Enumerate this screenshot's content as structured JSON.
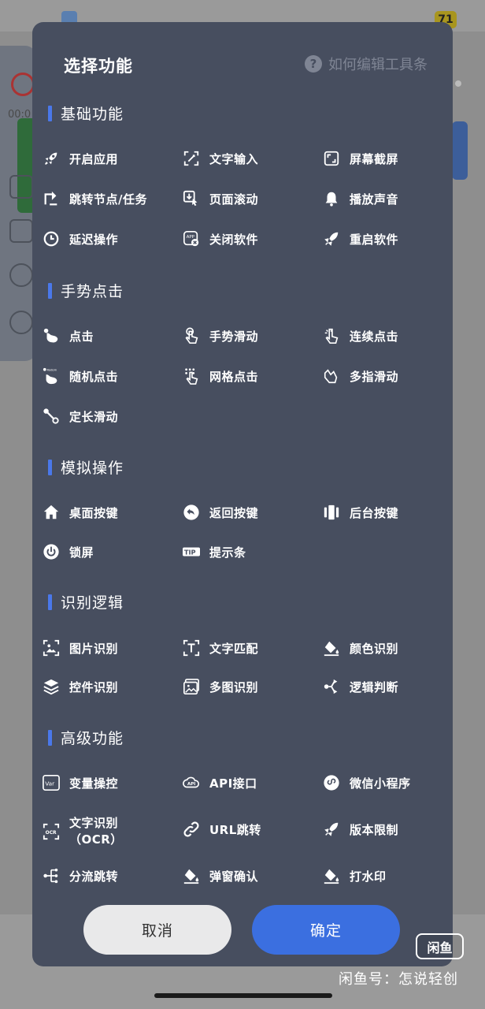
{
  "background": {
    "badge": "71",
    "side_time": "00:0"
  },
  "dialog": {
    "title": "选择功能",
    "help_label": "如何编辑工具条",
    "help_icon_glyph": "?"
  },
  "sections": [
    {
      "title": "基础功能",
      "items": [
        {
          "label": "开启应用",
          "icon": "rocket-icon"
        },
        {
          "label": "文字输入",
          "icon": "text-input-icon"
        },
        {
          "label": "屏幕截屏",
          "icon": "screenshot-icon"
        },
        {
          "label": "跳转节点/任务",
          "icon": "jump-icon"
        },
        {
          "label": "页面滚动",
          "icon": "scroll-icon"
        },
        {
          "label": "播放声音",
          "icon": "bell-icon"
        },
        {
          "label": "延迟操作",
          "icon": "clock-icon"
        },
        {
          "label": "关闭软件",
          "icon": "close-app-icon"
        },
        {
          "label": "重启软件",
          "icon": "restart-rocket-icon"
        }
      ]
    },
    {
      "title": "手势点击",
      "items": [
        {
          "label": "点击",
          "icon": "tap-icon"
        },
        {
          "label": "手势滑动",
          "icon": "swipe-icon"
        },
        {
          "label": "连续点击",
          "icon": "multi-tap-icon"
        },
        {
          "label": "随机点击",
          "icon": "random-tap-icon"
        },
        {
          "label": "网格点击",
          "icon": "grid-tap-icon"
        },
        {
          "label": "多指滑动",
          "icon": "multi-finger-icon"
        },
        {
          "label": "定长滑动",
          "icon": "fixed-swipe-icon"
        }
      ]
    },
    {
      "title": "模拟操作",
      "items": [
        {
          "label": "桌面按键",
          "icon": "home-icon"
        },
        {
          "label": "返回按键",
          "icon": "back-icon"
        },
        {
          "label": "后台按键",
          "icon": "recents-icon"
        },
        {
          "label": "锁屏",
          "icon": "power-icon"
        },
        {
          "label": "提示条",
          "icon": "tip-icon"
        }
      ]
    },
    {
      "title": "识别逻辑",
      "items": [
        {
          "label": "图片识别",
          "icon": "image-scan-icon"
        },
        {
          "label": "文字匹配",
          "icon": "text-match-icon"
        },
        {
          "label": "颜色识别",
          "icon": "paint-bucket-icon"
        },
        {
          "label": "控件识别",
          "icon": "layers-icon"
        },
        {
          "label": "多图识别",
          "icon": "multi-image-icon"
        },
        {
          "label": "逻辑判断",
          "icon": "branch-icon"
        }
      ]
    },
    {
      "title": "高级功能",
      "items": [
        {
          "label": "变量操控",
          "icon": "var-icon"
        },
        {
          "label": "API接口",
          "icon": "api-icon"
        },
        {
          "label": "微信小程序",
          "icon": "miniprogram-icon"
        },
        {
          "label": "文字识别\n（OCR）",
          "icon": "ocr-icon"
        },
        {
          "label": "URL跳转",
          "icon": "link-icon"
        },
        {
          "label": "版本限制",
          "icon": "version-rocket-icon"
        },
        {
          "label": "分流跳转",
          "icon": "split-icon"
        },
        {
          "label": "弹窗确认",
          "icon": "popup-bucket-icon"
        },
        {
          "label": "打水印",
          "icon": "watermark-bucket-icon"
        }
      ]
    }
  ],
  "buttons": {
    "cancel": "取消",
    "confirm": "确定"
  },
  "watermark": {
    "logo": "闲鱼",
    "text": "闲鱼号：怎说轻创"
  }
}
